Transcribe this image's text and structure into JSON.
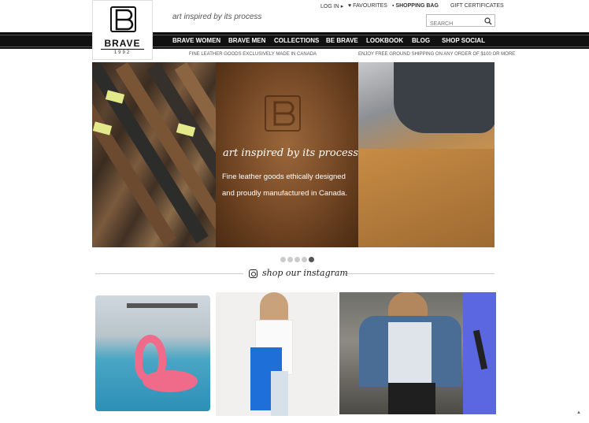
{
  "brand": {
    "name": "BRAVE",
    "year": "1992",
    "tagline_prefix": "art",
    "tagline_suffix": " inspired by its process"
  },
  "top_links": {
    "login": "LOG IN",
    "favourites": "FAVOURITES",
    "shopping_bag": "SHOPPING BAG",
    "gift": "GIFT CERTIFICATES"
  },
  "search": {
    "placeholder": "SEARCH"
  },
  "nav": [
    "BRAVE WOMEN",
    "BRAVE MEN",
    "COLLECTIONS",
    "BE BRAVE",
    "LOOKBOOK",
    "BLOG",
    "SHOP SOCIAL"
  ],
  "subbar": {
    "left": "FINE LEATHER GOODS EXCLUSIVELY MADE IN CANADA",
    "right": "ENJOY FREE GROUND SHIPPING ON ANY ORDER OF $100 OR MORE"
  },
  "hero": {
    "title": "art inspired by its process",
    "body": "Fine leather goods ethically designed and proudly manufactured in Canada.",
    "slides": 5,
    "active_slide": 5
  },
  "instagram": {
    "heading": "shop our instagram"
  },
  "colors": {
    "nav_bg": "#111111",
    "text": "#222222"
  }
}
